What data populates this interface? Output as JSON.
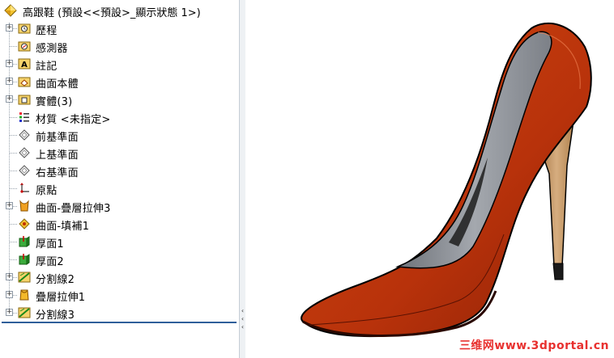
{
  "feature_tree": {
    "root_label": "高跟鞋  (預設<<預設>_顯示狀態 1>)",
    "items": [
      {
        "label": "歷程",
        "icon": "history-folder-icon",
        "expandable": true
      },
      {
        "label": "感測器",
        "icon": "sensor-icon",
        "expandable": false
      },
      {
        "label": "註記",
        "icon": "annotation-icon",
        "expandable": true
      },
      {
        "label": "曲面本體",
        "icon": "surface-bodies-icon",
        "expandable": true
      },
      {
        "label": "實體(3)",
        "icon": "solid-bodies-icon",
        "expandable": true
      },
      {
        "label": "材質 <未指定>",
        "icon": "material-icon",
        "expandable": false
      },
      {
        "label": "前基準面",
        "icon": "front-plane-icon",
        "expandable": false
      },
      {
        "label": "上基準面",
        "icon": "top-plane-icon",
        "expandable": false
      },
      {
        "label": "右基準面",
        "icon": "right-plane-icon",
        "expandable": false
      },
      {
        "label": "原點",
        "icon": "origin-icon",
        "expandable": false
      },
      {
        "label": "曲面-疊層拉伸3",
        "icon": "surface-loft-icon",
        "expandable": true
      },
      {
        "label": "曲面-填補1",
        "icon": "surface-fill-icon",
        "expandable": false
      },
      {
        "label": "厚面1",
        "icon": "thicken-icon",
        "expandable": false
      },
      {
        "label": "厚面2",
        "icon": "thicken-icon",
        "expandable": false
      },
      {
        "label": "分割線2",
        "icon": "split-line-icon",
        "expandable": true
      },
      {
        "label": "疊層拉伸1",
        "icon": "loft-icon",
        "expandable": true
      },
      {
        "label": "分割線3",
        "icon": "split-line-icon",
        "expandable": true
      }
    ]
  },
  "viewport": {
    "model": "high-heel-shoe",
    "watermark": "三维网www.3dportal.cn"
  },
  "colors": {
    "shoe_red": "#c53a0c",
    "shoe_dark": "#6e1503",
    "lining": "#8f939a",
    "heel_tan": "#c99c6c",
    "watermark": "#e8312f",
    "rollback_bar": "#2f5f9a"
  }
}
